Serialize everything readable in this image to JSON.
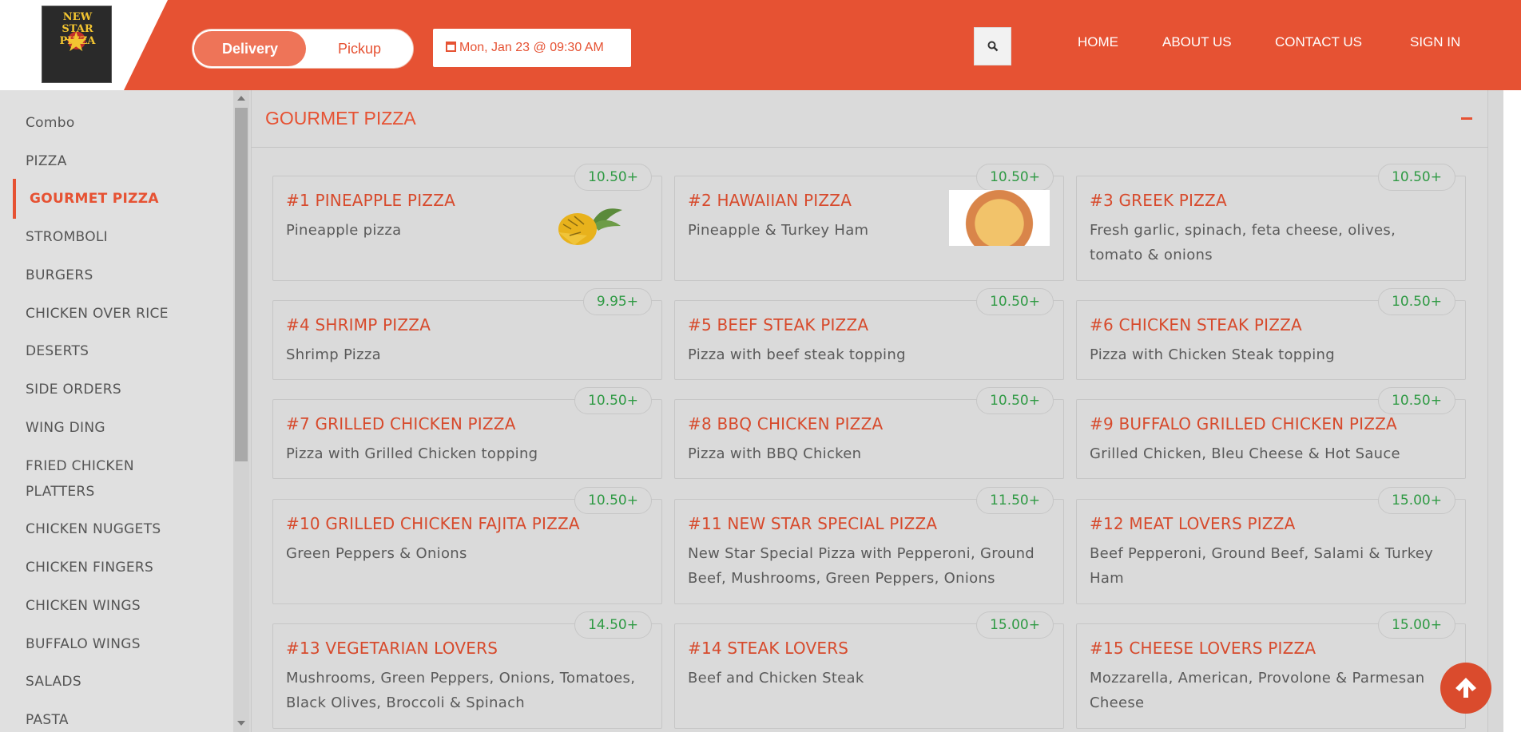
{
  "header": {
    "logo_text": "NEW STAR PIZZA",
    "order_toggle": {
      "delivery": "Delivery",
      "pickup": "Pickup",
      "selected": "Delivery"
    },
    "datetime": "Mon, Jan 23 @ 09:30 AM",
    "nav": [
      "HOME",
      "ABOUT US",
      "CONTACT US",
      "SIGN IN"
    ],
    "accent_color": "#e65233"
  },
  "sidebar": {
    "categories": [
      "Combo",
      "PIZZA",
      "GOURMET PIZZA",
      "STROMBOLI",
      "BURGERS",
      "CHICKEN OVER RICE",
      "DESERTS",
      "SIDE ORDERS",
      "WING DING",
      "FRIED CHICKEN",
      "PLATTERS",
      "CHICKEN NUGGETS",
      "CHICKEN FINGERS",
      "CHICKEN WINGS",
      "BUFFALO WINGS",
      "SALADS",
      "PASTA"
    ],
    "active": "GOURMET PIZZA"
  },
  "section": {
    "title": "GOURMET PIZZA"
  },
  "items": [
    {
      "title": "#1 PINEAPPLE PIZZA",
      "desc": "Pineapple pizza",
      "price": "10.50+",
      "image": "pineapple-image"
    },
    {
      "title": "#2 HAWAIIAN PIZZA",
      "desc": "Pineapple & Turkey Ham",
      "price": "10.50+",
      "image": "hawaiian-pizza-image"
    },
    {
      "title": "#3 GREEK PIZZA",
      "desc": "Fresh garlic, spinach, feta cheese, olives,",
      "desc2": "tomato & onions",
      "price": "10.50+"
    },
    {
      "title": "#4 SHRIMP PIZZA",
      "desc": "Shrimp Pizza",
      "price": "9.95+"
    },
    {
      "title": "#5 BEEF STEAK PIZZA",
      "desc": "Pizza with beef steak topping",
      "price": "10.50+"
    },
    {
      "title": "#6 CHICKEN STEAK PIZZA",
      "desc": "Pizza with Chicken Steak topping",
      "price": "10.50+"
    },
    {
      "title": "#7 GRILLED CHICKEN PIZZA",
      "desc": "Pizza with Grilled Chicken topping",
      "price": "10.50+"
    },
    {
      "title": "#8 BBQ CHICKEN PIZZA",
      "desc": "Pizza with BBQ Chicken",
      "price": "10.50+"
    },
    {
      "title": "#9 BUFFALO GRILLED CHICKEN PIZZA",
      "desc": "Grilled Chicken, Bleu Cheese & Hot Sauce",
      "price": "10.50+"
    },
    {
      "title": "#10 GRILLED CHICKEN FAJITA PIZZA",
      "desc": "Green Peppers & Onions",
      "price": "10.50+"
    },
    {
      "title": "#11 NEW STAR SPECIAL PIZZA",
      "desc": "New Star Special Pizza with Pepperoni, Ground",
      "desc2": "Beef, Mushrooms, Green Peppers, Onions",
      "price": "11.50+"
    },
    {
      "title": "#12 MEAT LOVERS PIZZA",
      "desc": "Beef Pepperoni, Ground Beef, Salami & Turkey",
      "desc2": "Ham",
      "price": "15.00+"
    },
    {
      "title": "#13 VEGETARIAN LOVERS",
      "desc": "Mushrooms, Green Peppers, Onions, Tomatoes,",
      "desc2": "Black Olives, Broccoli & Spinach",
      "price": "14.50+"
    },
    {
      "title": "#14 STEAK LOVERS",
      "desc": "Beef and Chicken Steak",
      "price": "15.00+"
    },
    {
      "title": "#15 CHEESE LOVERS PIZZA",
      "desc": "Mozzarella, American, Provolone & Parmesan",
      "desc2": "Cheese",
      "price": "15.00+"
    }
  ]
}
